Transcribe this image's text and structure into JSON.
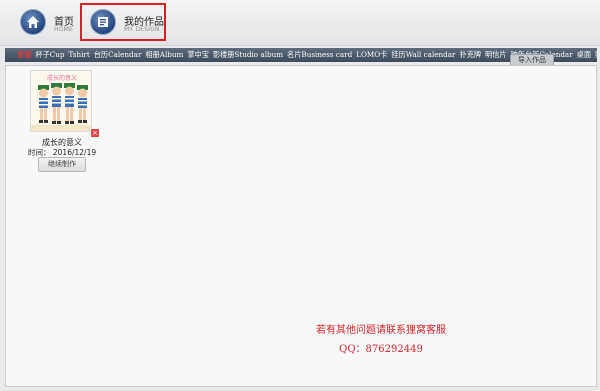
{
  "nav": {
    "home": {
      "title": "首页",
      "subtitle": "HOME"
    },
    "mine": {
      "title": "我的作品",
      "subtitle": "MY DESIGN"
    }
  },
  "categories": [
    "全部",
    "杯子Cup",
    "Tshirt",
    "台历Calendar",
    "相册Album",
    "掌中宝",
    "影楼册Studio album",
    "名片Business card",
    "LOMO卡",
    "挂历Wall calendar",
    "扑克牌",
    "明信片",
    "跨年台历Calendar",
    "桌面",
    "照片"
  ],
  "import_button": "导入作品",
  "works": [
    {
      "title": "成长的意义",
      "time_label": "时间：",
      "time": "2016/12/19",
      "action": "继续制作",
      "thumb_caption": "成长的意义"
    }
  ],
  "help": {
    "text": "若有其他问题请联系狸窝客服",
    "qq": "QQ：876292449"
  },
  "colors": {
    "nav_highlight": "#d42026",
    "category_bar": "#4a5666",
    "active_category": "#e53a3a",
    "help_text": "#d4262b"
  },
  "icons": {
    "home": "house-icon",
    "mine": "book-icon",
    "delete": "close-icon"
  }
}
